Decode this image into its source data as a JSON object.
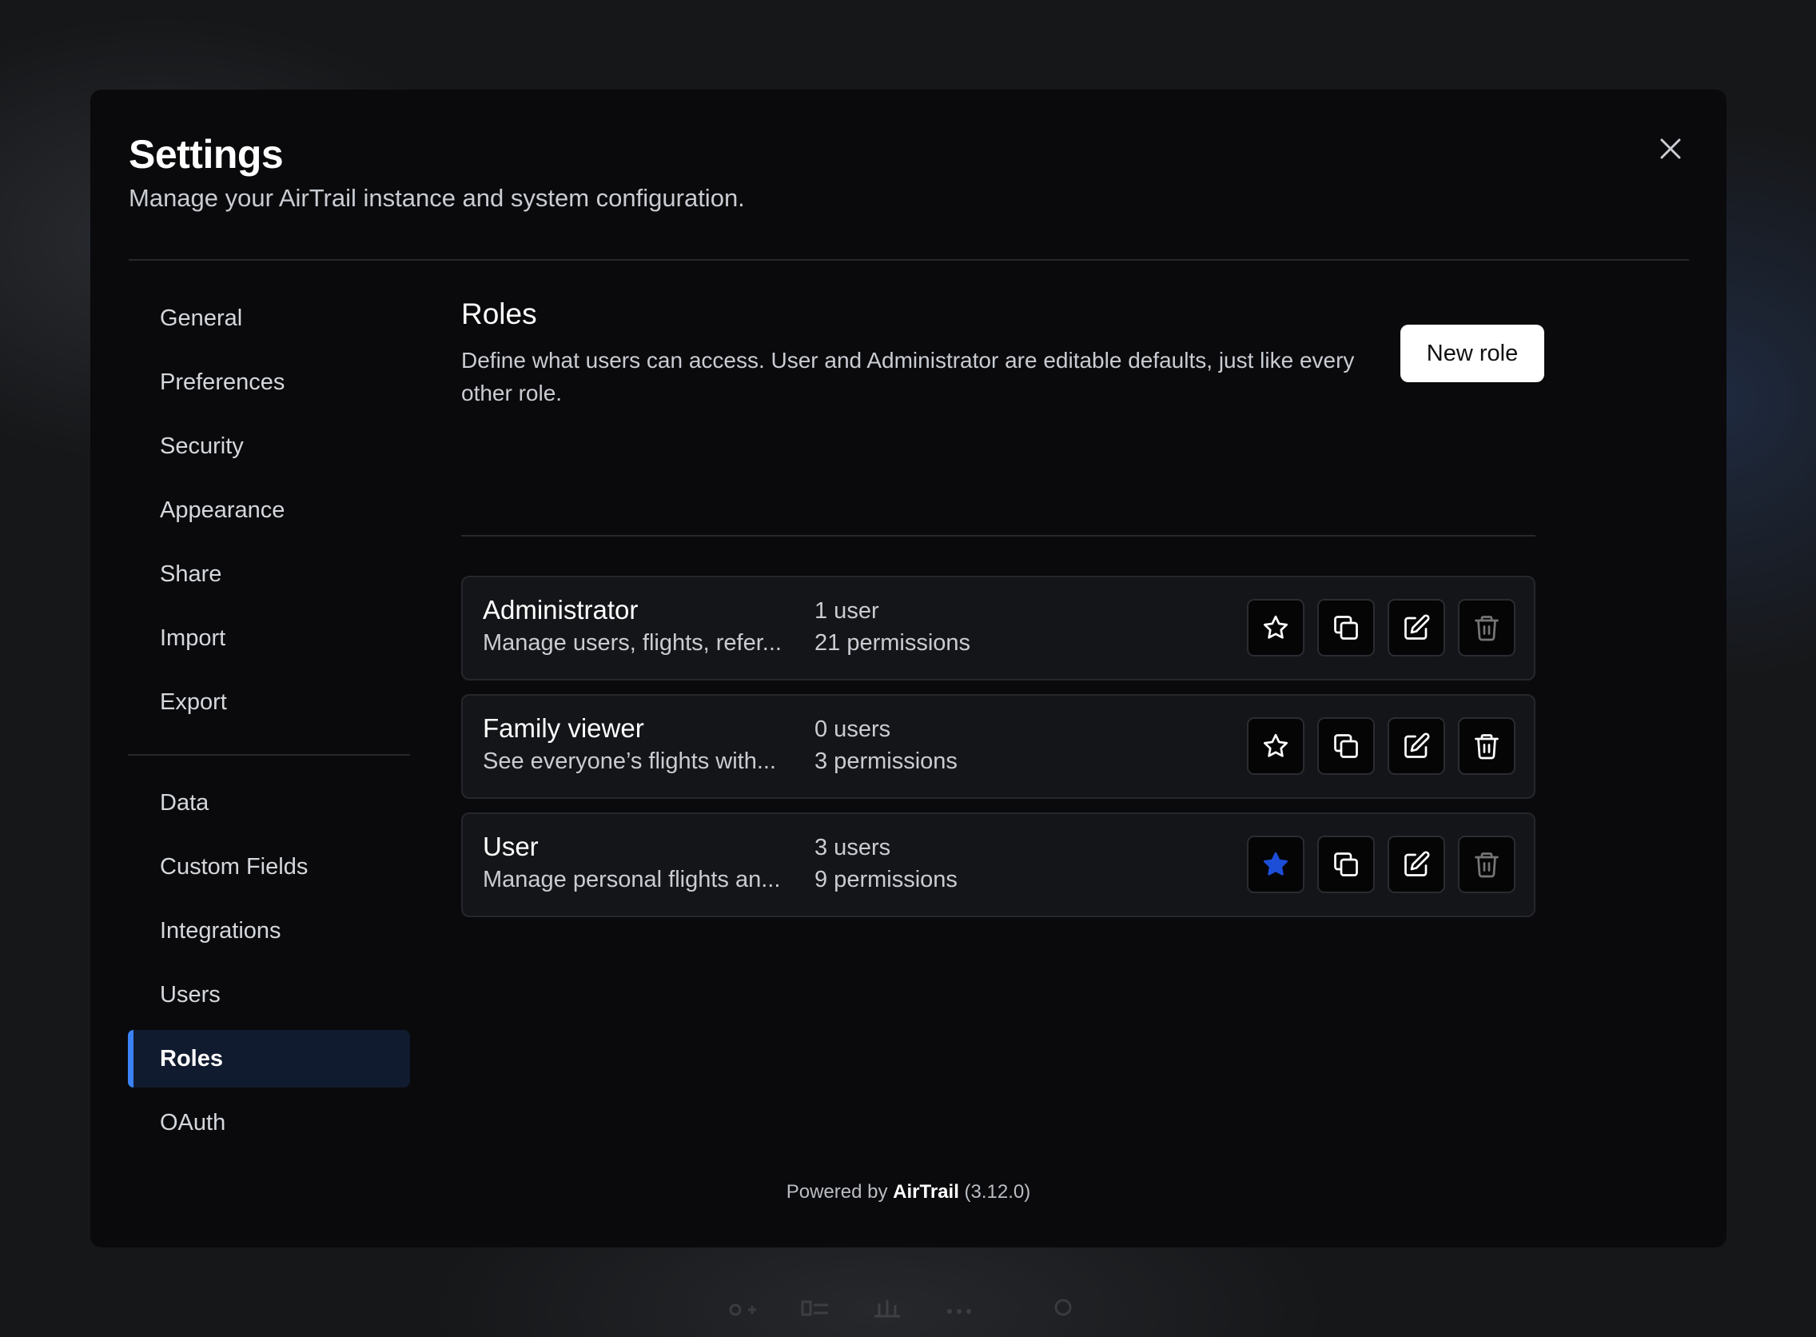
{
  "modal": {
    "title": "Settings",
    "subtitle": "Manage your AirTrail instance and system configuration."
  },
  "sidebar": {
    "group1": [
      "General",
      "Preferences",
      "Security",
      "Appearance",
      "Share",
      "Import",
      "Export"
    ],
    "group2": [
      "Data",
      "Custom Fields",
      "Integrations",
      "Users",
      "Roles",
      "OAuth"
    ],
    "active": "Roles"
  },
  "roles": {
    "title": "Roles",
    "description": "Define what users can access. User and Administrator are editable defaults, just like every other role.",
    "new_role_label": "New role",
    "items": [
      {
        "name": "Administrator",
        "description": "Manage users, flights, refer...",
        "users": "1 user",
        "permissions": "21 permissions",
        "is_default": false,
        "deletable": false
      },
      {
        "name": "Family viewer",
        "description": "See everyone’s flights with...",
        "users": "0 users",
        "permissions": "3 permissions",
        "is_default": false,
        "deletable": true
      },
      {
        "name": "User",
        "description": "Manage personal flights an...",
        "users": "3 users",
        "permissions": "9 permissions",
        "is_default": true,
        "deletable": false
      }
    ]
  },
  "footer": {
    "prefix": "Powered by",
    "brand": "AirTrail",
    "version": "(3.12.0)"
  },
  "colors": {
    "accent": "#3b82f6",
    "star_filled": "#1d4ed8",
    "modal_bg": "#0a0a0c",
    "card_bg": "#141518"
  },
  "icons": {
    "close": "close-icon",
    "default": "star-icon",
    "duplicate": "copy-icon",
    "edit": "edit-icon",
    "delete": "trash-icon"
  }
}
